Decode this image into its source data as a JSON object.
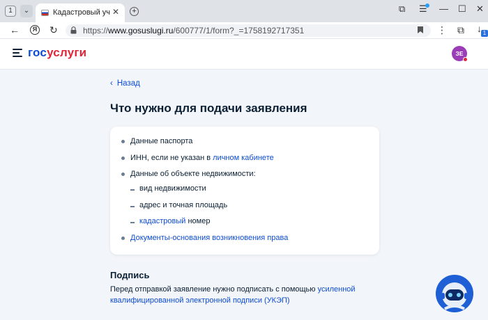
{
  "browser": {
    "tab_counter": "1",
    "tab_title": "Кадастровый учёт и р…",
    "url_prefix": "https://",
    "url_host": "www.gosuslugi.ru",
    "url_path": "/600777/1/form?_=1758192717351",
    "download_badge": "1"
  },
  "header": {
    "logo_part1": "гос",
    "logo_part2": "услуги",
    "avatar_initials": "ЗЕ"
  },
  "content": {
    "back_label": "Назад",
    "title": "Что нужно для подачи заявления",
    "items": [
      {
        "text": "Данные паспорта"
      },
      {
        "text_before": "ИНН, если не указан в ",
        "link": "личном кабинете"
      },
      {
        "text": "Данные об объекте недвижимости:"
      },
      {
        "sub": "вид недвижимости"
      },
      {
        "sub": "адрес и точная площадь"
      },
      {
        "sub_link": "кадастровый",
        "sub_after": " номер"
      },
      {
        "link_only": "Документы-основания возникновения права"
      }
    ],
    "signature": {
      "title": "Подпись",
      "text_before": "Перед отправкой заявление нужно подписать с помощью ",
      "link": "усиленной квалифицированной электронной подписи (УКЭП)"
    }
  },
  "colors": {
    "brand_blue": "#0d4cd3",
    "brand_red": "#e2263a",
    "text": "#0b1f33",
    "page_bg": "#f2f5f9",
    "avatar_bg": "#9b3db7"
  }
}
